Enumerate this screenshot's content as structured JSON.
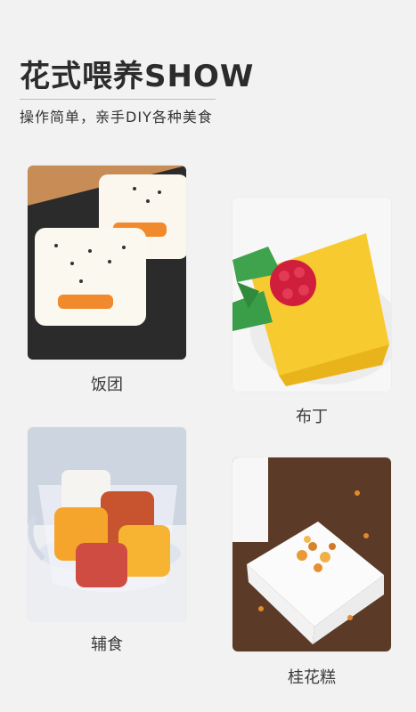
{
  "header": {
    "title": "花式喂养SHOW",
    "subtitle": "操作简单，亲手DIY各种美食"
  },
  "cards": [
    {
      "label": "饭团",
      "image": "rice-ball-photo"
    },
    {
      "label": "布丁",
      "image": "pudding-photo"
    },
    {
      "label": "辅食",
      "image": "baby-food-cup-photo"
    },
    {
      "label": "桂花糕",
      "image": "osmanthus-cake-photo"
    }
  ]
}
